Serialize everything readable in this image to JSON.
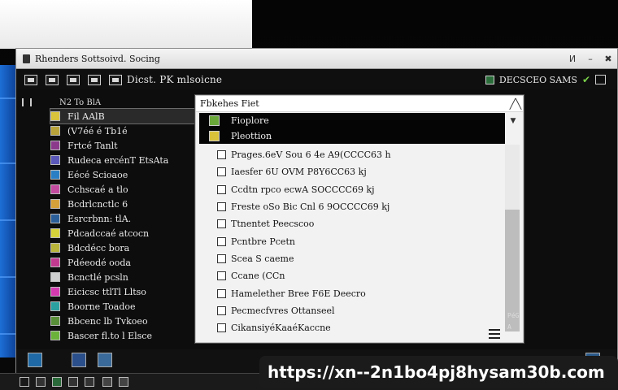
{
  "window": {
    "title": "Rhenders Sottsoivd. Socing",
    "controls": [
      "И",
      "–",
      "✖"
    ]
  },
  "toolbar": {
    "title": "Dicst. PK mlsoicne",
    "right_label": "DECSCEO SAMS"
  },
  "file_list_header": {
    "label": "N2 To BlA"
  },
  "file_list": [
    {
      "label": "Fil AAlB",
      "thumb_color": "#d9c33c",
      "selected": true
    },
    {
      "label": "(V7éé é Tb1é",
      "thumb_color": "#b8a23a",
      "selected": false
    },
    {
      "label": "Frtcé Tanlt",
      "thumb_color": "#8b3a8b",
      "selected": false
    },
    {
      "label": "Rudeca ercénT EtsAta",
      "thumb_color": "#5a58b8",
      "selected": false
    },
    {
      "label": "Eécé Scioaoe",
      "thumb_color": "#2a7fc4",
      "selected": false
    },
    {
      "label": "Cchscaé a tlo",
      "thumb_color": "#c24ba0",
      "selected": false
    },
    {
      "label": "Bcdrlcnctlc 6",
      "thumb_color": "#d4a03a",
      "selected": false
    },
    {
      "label": "Esrcrbnn: tlA.",
      "thumb_color": "#2b5f9a",
      "selected": false
    },
    {
      "label": "Pdcadccaé atcocn",
      "thumb_color": "#d6d23a",
      "selected": false
    },
    {
      "label": "Bdcdécc bora",
      "thumb_color": "#b9b43a",
      "selected": false
    },
    {
      "label": "Pdéeodé ooda",
      "thumb_color": "#c23a8f",
      "selected": false
    },
    {
      "label": "Bcnctlé pcsln",
      "thumb_color": "#cfcfcf",
      "selected": false
    },
    {
      "label": "Eicicsc ttlTl Lltso",
      "thumb_color": "#d43ab0",
      "selected": false
    },
    {
      "label": "Boorne Toadoe",
      "thumb_color": "#2aa0a0",
      "selected": false
    },
    {
      "label": "Bbcenc lb Tvkoeo",
      "thumb_color": "#5a8f3a",
      "selected": false
    },
    {
      "label": "Bascer fl.to l Elsce",
      "thumb_color": "#6ab23a",
      "selected": false
    }
  ],
  "dialog": {
    "title": "Fbkehes Fiet",
    "dropdown_items": [
      {
        "label": "Fioplore",
        "icon_color": "#6aa83a"
      },
      {
        "label": "Pleottion",
        "icon_color": "#d9c23a"
      }
    ],
    "check_items": [
      "Prages.6eV Sou 6 4e A9(CCCC63 h",
      "Iaesfer 6U OVM P8Y6CC63 kj",
      "Ccdtn rpco ecwA SOCCCC69 kj",
      "Freste oSo Bic Cnl 6 9OCCCC69 kj",
      "Ttnentet Peecscoo",
      "Pcntbre Pcetn",
      "Scea S caeme",
      "Ccane (CCn",
      "Hamelether Bree F6E Deecro",
      "Pecmecfvres Ottanseel",
      "CikansiyéKaaéKaccne"
    ]
  },
  "side_values": {
    "v1": "PéG",
    "v2": "A"
  },
  "url": "https://xn--2n1bo4pj8hysam30b.com"
}
